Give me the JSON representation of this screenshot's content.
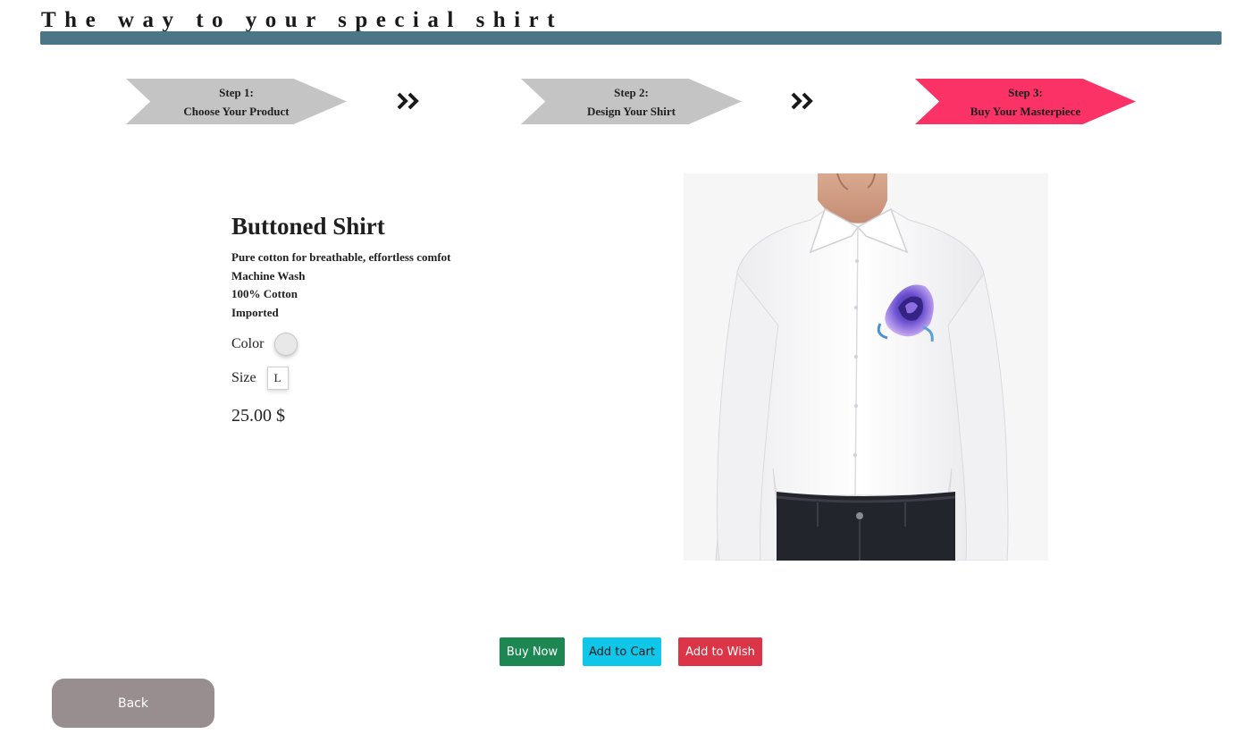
{
  "header": {
    "title": "The way to your special shirt",
    "bar_color": "#4a7686"
  },
  "steps": [
    {
      "line1": "Step 1:",
      "line2": "Choose Your Product",
      "state": "inactive"
    },
    {
      "line1": "Step 2:",
      "line2": "Design Your Shirt",
      "state": "inactive"
    },
    {
      "line1": "Step 3:",
      "line2": "Buy Your Masterpiece",
      "state": "active"
    }
  ],
  "separator_icon": "double-chevron-right-icon",
  "product": {
    "title": "Buttoned Shirt",
    "features": [
      "Pure cotton for breathable, effortless comfot",
      "Machine Wash",
      "100% Cotton",
      "Imported"
    ],
    "color_label": "Color",
    "color_value": "#e8e8e8",
    "size_label": "Size",
    "size_value": "L",
    "price": "25.00 $"
  },
  "image": {
    "subject": "white buttoned shirt with purple rose print"
  },
  "actions": {
    "buy_now": "Buy Now",
    "add_to_cart": "Add to Cart",
    "add_to_wish": "Add to Wish",
    "back": "Back"
  },
  "colors": {
    "step_inactive": "#c4c4c4",
    "step_active": "#fb3265",
    "buy_now": "#1c8752",
    "add_to_cart": "#10c7ea",
    "add_to_wish": "#dd3548",
    "back": "#998e8f"
  }
}
